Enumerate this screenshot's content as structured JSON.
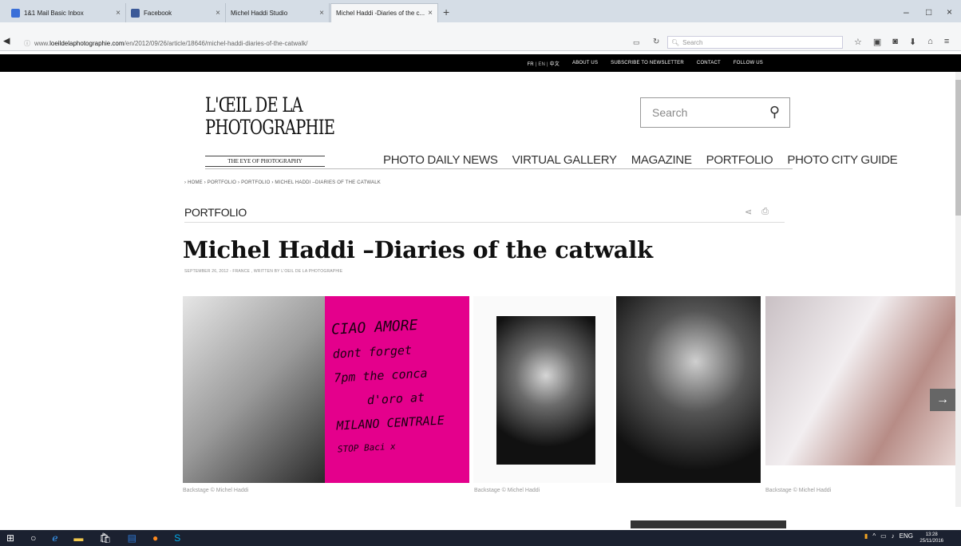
{
  "browser": {
    "tabs": [
      {
        "label": "1&1 Mail Basic Inbox",
        "favicon_color": "#3a6fd8"
      },
      {
        "label": "Facebook",
        "favicon_color": "#3b5998"
      },
      {
        "label": "Michel Haddi Studio",
        "favicon_color": "#cccccc"
      },
      {
        "label": "Michel Haddi -Diaries of the c...",
        "favicon_color": "#cccccc"
      }
    ],
    "new_tab": "+",
    "url_prefix": "www.",
    "url_domain": "loeildelaphotographie.com",
    "url_path": "/en/2012/09/26/article/18646/michel-haddi-diaries-of-the-catwalk/",
    "search_placeholder": "Search",
    "window_controls": [
      "–",
      "□",
      "×"
    ]
  },
  "site": {
    "topnav": {
      "lang_fr": "FR",
      "lang_en": "EN",
      "lang_zh": "中文",
      "about": "ABOUT US",
      "newsletter": "SUBSCRIBE TO NEWSLETTER",
      "contact": "CONTACT",
      "follow": "FOLLOW US"
    },
    "logo_line1": "L'ŒIL DE LA",
    "logo_line2": "PHOTOGRAPHIE",
    "tagline": "THE EYE OF PHOTOGRAPHY",
    "search_placeholder": "Search",
    "mainnav": [
      "PHOTO DAILY NEWS",
      "VIRTUAL GALLERY",
      "MAGAZINE",
      "PORTFOLIO",
      "PHOTO CITY GUIDE"
    ],
    "breadcrumb": "› HOME › PORTFOLIO › PORTFOLIO › MICHEL HADDI –DIARIES OF THE CATWALK",
    "section": "PORTFOLIO",
    "headline": "Michel Haddi –Diaries of the catwalk",
    "byline": "SEPTEMBER 26, 2012 - FRANCE , WRITTEN BY L'OEIL DE LA PHOTOGRAPHIE",
    "handwritten_lines": [
      "CIAO AMORE",
      "dont forget",
      "7pm the conca",
      "d'oro at",
      "MILANO CENTRALE",
      "STOP Baci x"
    ],
    "captions": [
      "Backstage © Michel Haddi",
      "Backstage © Michel Haddi",
      "Backstage © Michel Haddi"
    ],
    "next_arrow": "→",
    "accent_magenta": "#e4008c"
  },
  "taskbar": {
    "lang": "ENG",
    "time": "13:28",
    "date": "25/11/2016"
  }
}
